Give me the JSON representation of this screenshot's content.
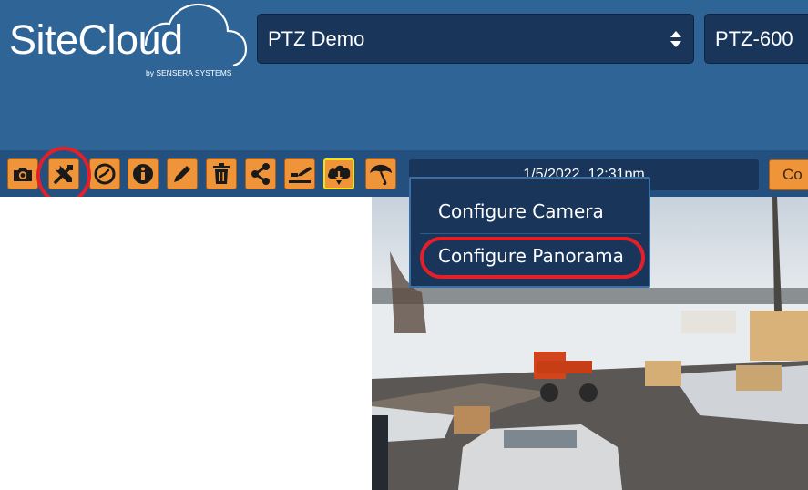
{
  "brand": {
    "name": "SiteCloud",
    "byline": "by SENSERA SYSTEMS"
  },
  "header": {
    "site_select": {
      "value": "PTZ Demo"
    },
    "camera_select": {
      "value": "PTZ-600"
    }
  },
  "toolbar": {
    "buttons": [
      {
        "icon": "camera-icon"
      },
      {
        "icon": "tools-icon",
        "highlighted": true
      },
      {
        "icon": "clock-icon"
      },
      {
        "icon": "info-icon"
      },
      {
        "icon": "pencil-icon"
      },
      {
        "icon": "trash-icon"
      },
      {
        "icon": "share-icon"
      },
      {
        "icon": "upload-icon"
      },
      {
        "icon": "cloud-download-icon",
        "active": true
      },
      {
        "icon": "umbrella-icon"
      }
    ],
    "timestamp": "1/5/2022, 12:31pm",
    "right_button_label": "Co"
  },
  "config_menu": {
    "items": [
      {
        "label": "Configure Camera"
      },
      {
        "label": "Configure Panorama",
        "highlighted": true
      }
    ]
  },
  "colors": {
    "header_bg": "#2f6496",
    "toolbar_bg": "#23507f",
    "button_orange": "#f0943a",
    "dark_navy": "#19355a",
    "highlight_red": "#e3202a",
    "active_yellow": "#f2e21a"
  }
}
